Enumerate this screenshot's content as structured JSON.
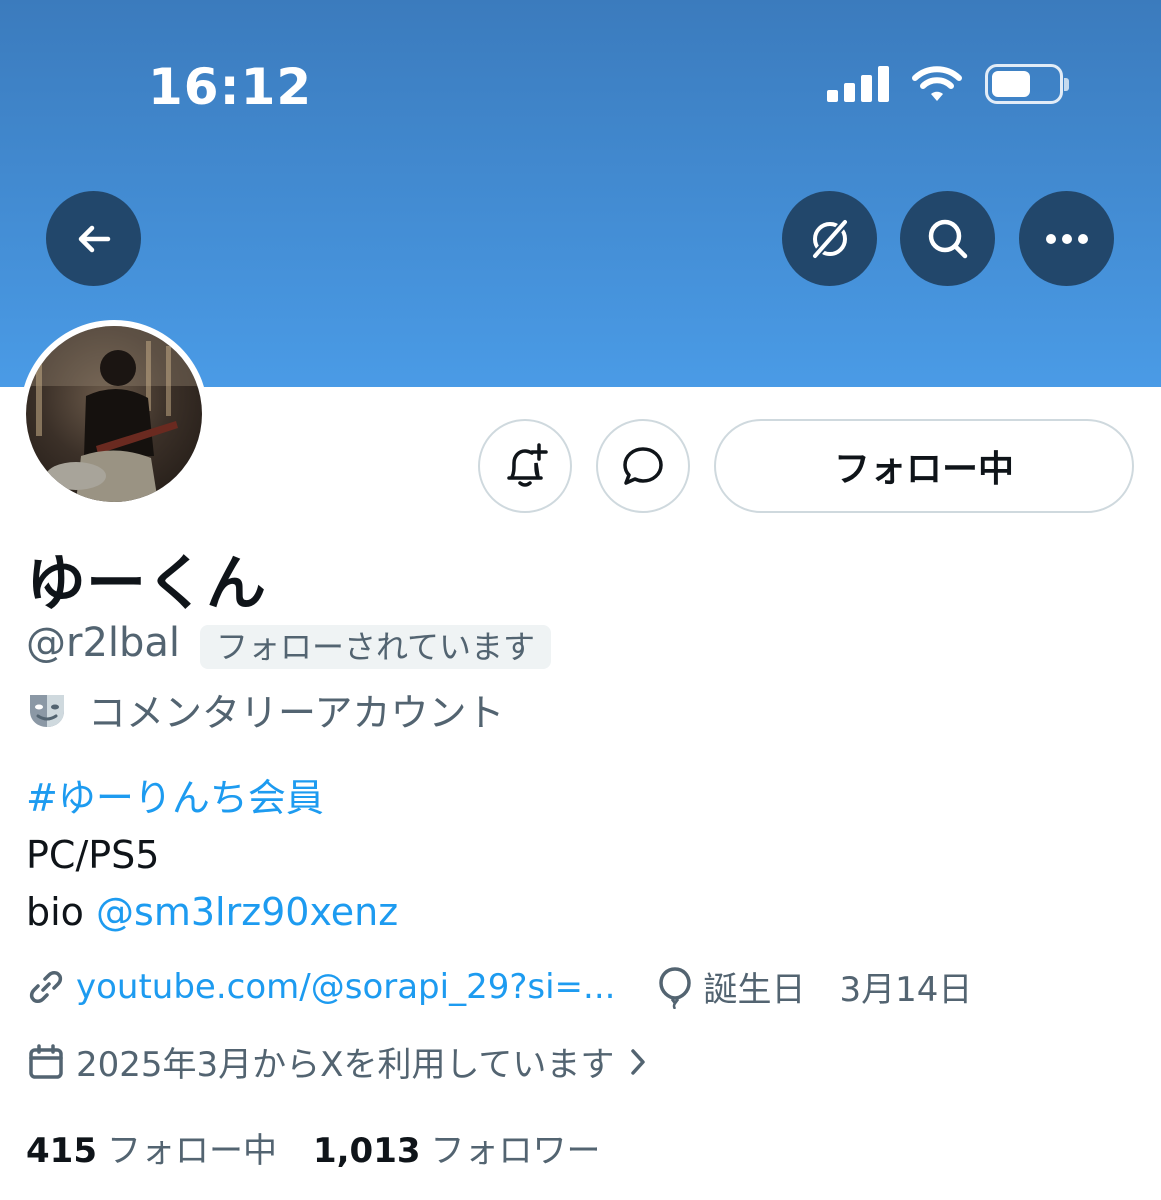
{
  "status_bar": {
    "time": "16:12"
  },
  "header": {
    "banner_color": "#4a9be6",
    "button_color": "#22476b"
  },
  "nav": {
    "back_icon": "arrow-left-icon",
    "grok_icon": "grok-icon",
    "search_icon": "search-icon",
    "more_icon": "more-horizontal-icon"
  },
  "actions": {
    "notify_icon": "bell-plus-icon",
    "message_icon": "chat-bubble-icon",
    "follow_label": "フォロー中"
  },
  "profile": {
    "display_name": "ゆーくん",
    "handle": "@r2lbal",
    "follows_you": "フォローされています",
    "category": "コメンタリーアカウント"
  },
  "bio": {
    "hashtag": "#ゆーりんち会員",
    "line2": "PC/PS5",
    "line3_prefix": "bio ",
    "line3_mention": "@sm3lrz90xenz"
  },
  "meta": {
    "url": "youtube.com/@sorapi_29?si=...",
    "birthday_label": "誕生日",
    "birthday_value": "3月14日",
    "joined": "2025年3月からXを利用しています"
  },
  "stats": {
    "following_count": "415",
    "following_label": "フォロー中",
    "followers_count": "1,013",
    "followers_label": "フォロワー"
  },
  "accent_color": "#1d9bf0"
}
